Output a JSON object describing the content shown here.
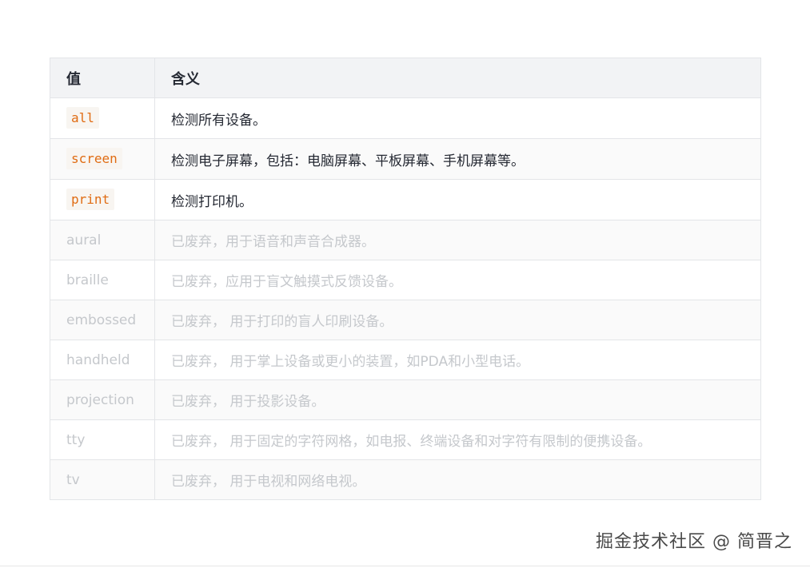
{
  "table": {
    "headers": {
      "value": "值",
      "meaning": "含义"
    },
    "rows": [
      {
        "value": "all",
        "meaning": "检测所有设备。",
        "deprecated": false
      },
      {
        "value": "screen",
        "meaning": "检测电子屏幕，包括：电脑屏幕、平板屏幕、手机屏幕等。",
        "deprecated": false
      },
      {
        "value": "print",
        "meaning": "检测打印机。",
        "deprecated": false
      },
      {
        "value": "aural",
        "meaning": "已废弃，用于语音和声音合成器。",
        "deprecated": true
      },
      {
        "value": "braille",
        "meaning": "已废弃，应用于盲文触摸式反馈设备。",
        "deprecated": true
      },
      {
        "value": "embossed",
        "meaning": "已废弃， 用于打印的盲人印刷设备。",
        "deprecated": true
      },
      {
        "value": "handheld",
        "meaning": "已废弃， 用于掌上设备或更小的装置，如PDA和小型电话。",
        "deprecated": true
      },
      {
        "value": "projection",
        "meaning": "已废弃， 用于投影设备。",
        "deprecated": true
      },
      {
        "value": "tty",
        "meaning": "已废弃， 用于固定的字符网格，如电报、终端设备和对字符有限制的便携设备。",
        "deprecated": true
      },
      {
        "value": "tv",
        "meaning": "已废弃， 用于电视和网络电视。",
        "deprecated": true
      }
    ]
  },
  "watermark": "掘金技术社区 @ 简晋之"
}
